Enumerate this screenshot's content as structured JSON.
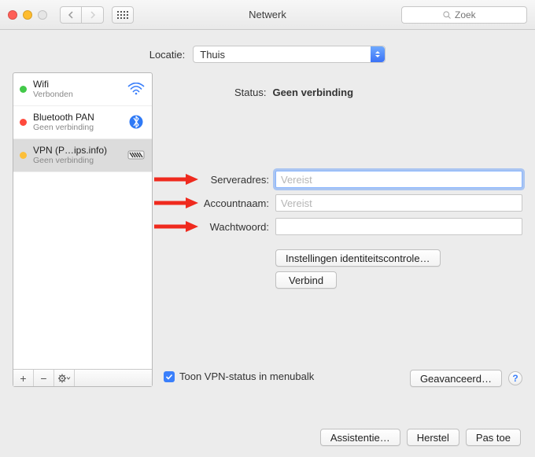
{
  "window": {
    "title": "Netwerk",
    "search_placeholder": "Zoek"
  },
  "location": {
    "label": "Locatie:",
    "selected": "Thuis"
  },
  "sidebar": {
    "items": [
      {
        "name": "Wifi",
        "status": "Verbonden",
        "dot": "#42c949",
        "icon": "wifi"
      },
      {
        "name": "Bluetooth PAN",
        "status": "Geen verbinding",
        "dot": "#ff4a3d",
        "icon": "bluetooth"
      },
      {
        "name": "VPN (P…ips.info)",
        "status": "Geen verbinding",
        "dot": "#fcbf3a",
        "icon": "vpn"
      }
    ]
  },
  "detail": {
    "status_label": "Status:",
    "status_value": "Geen verbinding",
    "fields": {
      "server": {
        "label": "Serveradres:",
        "placeholder": "Vereist",
        "value": ""
      },
      "account": {
        "label": "Accountnaam:",
        "placeholder": "Vereist",
        "value": ""
      },
      "password": {
        "label": "Wachtwoord:",
        "placeholder": "",
        "value": ""
      }
    },
    "auth_settings_btn": "Instellingen identiteitscontrole…",
    "connect_btn": "Verbind",
    "show_status_checkbox": "Toon VPN-status in menubalk",
    "advanced_btn": "Geavanceerd…"
  },
  "footer": {
    "assist": "Assistentie…",
    "revert": "Herstel",
    "apply": "Pas toe"
  },
  "colors": {
    "accent": "#3a7ffb",
    "arrow": "#ef2a1e"
  }
}
